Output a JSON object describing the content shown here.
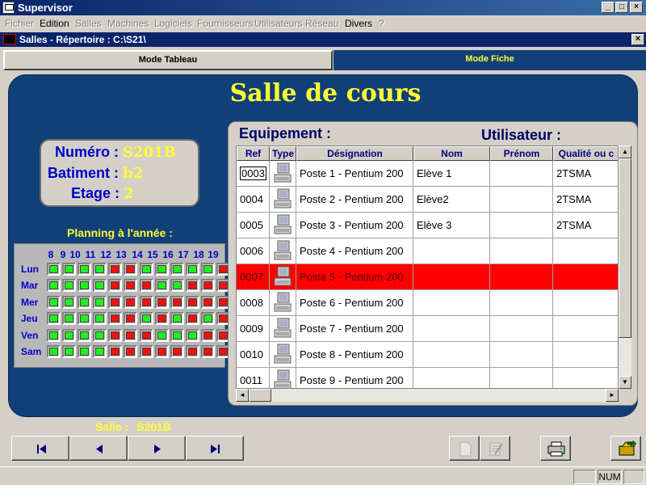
{
  "window": {
    "title": "Supervisor"
  },
  "menu": [
    {
      "label": "Fichier",
      "disabled": true
    },
    {
      "label": "Edition",
      "disabled": false
    },
    {
      "label": "Salles",
      "disabled": true
    },
    {
      "label": "Machines",
      "disabled": true
    },
    {
      "label": "Logiciels",
      "disabled": true
    },
    {
      "label": "Fournisseurs",
      "disabled": true
    },
    {
      "label": "Utilisateurs",
      "disabled": true
    },
    {
      "label": "Réseau",
      "disabled": true
    },
    {
      "label": "Divers",
      "disabled": false
    },
    {
      "label": "?",
      "disabled": true
    }
  ],
  "child_window": {
    "title": "Salles - Répertoire : C:\\S21\\"
  },
  "tabs": {
    "tableau": "Mode Tableau",
    "fiche": "Mode Fiche",
    "active": "fiche"
  },
  "page": {
    "title": "Salle de cours"
  },
  "info": {
    "numero_label": "Numéro :",
    "numero_value": "S201B",
    "batiment_label": "Batiment :",
    "batiment_value": "b2",
    "etage_label": "Etage :",
    "etage_value": "2"
  },
  "planning": {
    "label": "Planning à l'année :",
    "hours": [
      "8",
      "9",
      "10",
      "11",
      "12",
      "13",
      "14",
      "15",
      "16",
      "17",
      "18",
      "19"
    ],
    "days": [
      {
        "label": "Lun",
        "slots": [
          "free",
          "free",
          "free",
          "free",
          "busy",
          "busy",
          "free",
          "free",
          "free",
          "free",
          "free",
          "busy"
        ]
      },
      {
        "label": "Mar",
        "slots": [
          "free",
          "free",
          "free",
          "free",
          "busy",
          "busy",
          "busy",
          "free",
          "free",
          "busy",
          "busy",
          "busy"
        ]
      },
      {
        "label": "Mer",
        "slots": [
          "free",
          "free",
          "free",
          "free",
          "busy",
          "busy",
          "busy",
          "busy",
          "busy",
          "busy",
          "busy",
          "busy"
        ]
      },
      {
        "label": "Jeu",
        "slots": [
          "free",
          "free",
          "free",
          "free",
          "busy",
          "busy",
          "free",
          "busy",
          "free",
          "busy",
          "free",
          "busy"
        ]
      },
      {
        "label": "Ven",
        "slots": [
          "free",
          "free",
          "free",
          "free",
          "busy",
          "busy",
          "busy",
          "free",
          "free",
          "free",
          "busy",
          "busy"
        ]
      },
      {
        "label": "Sam",
        "slots": [
          "free",
          "free",
          "free",
          "free",
          "busy",
          "busy",
          "busy",
          "busy",
          "busy",
          "busy",
          "busy",
          "busy"
        ]
      }
    ],
    "colors": {
      "free": "#22ee22",
      "busy": "#ee1111"
    }
  },
  "table": {
    "equipement_label": "Equipement :",
    "utilisateur_label": "Utilisateur :",
    "columns": [
      "Ref",
      "Type",
      "Désignation",
      "Nom",
      "Prénom",
      "Qualité ou c"
    ],
    "rows": [
      {
        "ref": "0003",
        "designation": "Poste 1 - Pentium 200",
        "nom": "Elève 1",
        "prenom": "",
        "qualite": "2TSMA"
      },
      {
        "ref": "0004",
        "designation": "Poste 2 - Pentium 200",
        "nom": "Elève2",
        "prenom": "",
        "qualite": "2TSMA"
      },
      {
        "ref": "0005",
        "designation": "Poste 3 - Pentium 200",
        "nom": "Elève 3",
        "prenom": "",
        "qualite": "2TSMA"
      },
      {
        "ref": "0006",
        "designation": "Poste 4 - Pentium 200",
        "nom": "",
        "prenom": "",
        "qualite": ""
      },
      {
        "ref": "0007",
        "designation": "Poste 5 - Pentium 200",
        "nom": "",
        "prenom": "",
        "qualite": ""
      },
      {
        "ref": "0008",
        "designation": "Poste 6 - Pentium 200",
        "nom": "",
        "prenom": "",
        "qualite": ""
      },
      {
        "ref": "0009",
        "designation": "Poste 7 - Pentium 200",
        "nom": "",
        "prenom": "",
        "qualite": ""
      },
      {
        "ref": "0010",
        "designation": "Poste 8 - Pentium 200",
        "nom": "",
        "prenom": "",
        "qualite": ""
      },
      {
        "ref": "0011",
        "designation": "Poste 9 - Pentium 200",
        "nom": "",
        "prenom": "",
        "qualite": ""
      }
    ],
    "highlight_color": "#ff0000"
  },
  "footer": {
    "salle_label": "Salle :",
    "salle_value": "S201B"
  },
  "statusbar": {
    "num": "NUM"
  },
  "icons": {
    "nav": [
      "first-record-icon",
      "previous-record-icon",
      "next-record-icon",
      "last-record-icon"
    ],
    "tools": [
      "new-document-icon",
      "edit-document-icon",
      "print-icon",
      "exit-icon"
    ]
  }
}
